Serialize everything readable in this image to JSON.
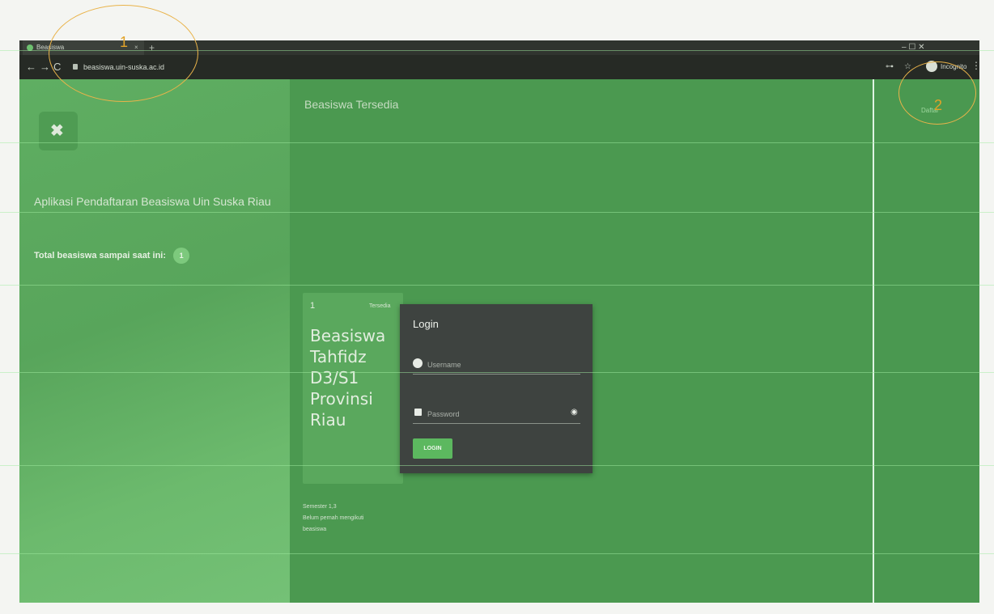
{
  "browser": {
    "tab_title": "Beasiswa",
    "tab_close": "×",
    "new_tab": "+",
    "window_controls": "–  ☐  ✕",
    "nav_back": "←",
    "nav_forward": "→",
    "nav_reload": "C",
    "url": "beasiswa.uin-suska.ac.id",
    "key_icon": "⊶",
    "star_icon": "☆",
    "profile_label": "Incognito",
    "menu_dots": "⋮"
  },
  "sidebar": {
    "logo_mark": "✖",
    "app_title": "Aplikasi Pendaftaran Beasiswa Uin Suska Riau",
    "total_label": "Total beasiswa sampai saat ini:",
    "total_count": "1"
  },
  "main": {
    "title": "Beasiswa Tersedia",
    "card": {
      "number": "1",
      "status": "Tersedia",
      "title": "Beasiswa\nTahfidz\nD3/S1\nProvinsi\nRiau",
      "meta_1": "Semester 1,3",
      "meta_2": "Belum pernah mengikuti",
      "meta_3": "beasiswa"
    }
  },
  "login": {
    "title": "Login",
    "username_placeholder": "Username",
    "password_placeholder": "Password",
    "button": "LOGIN"
  },
  "right": {
    "daftar": "Daftar"
  },
  "annotations": {
    "label_1": "1",
    "label_2": "2"
  },
  "colors": {
    "overlay_green": "#4c9a52",
    "browser_dark": "#262a25",
    "login_panel": "#3e4340",
    "login_button": "#5cb85f",
    "annotation_orange": "#e9b34a"
  }
}
